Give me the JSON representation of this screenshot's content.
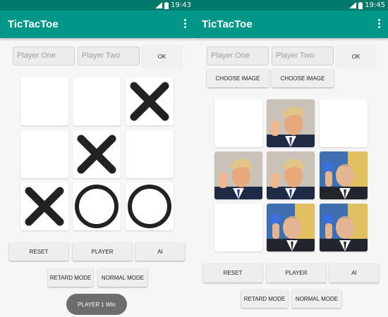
{
  "status_bar": {
    "left_time": "19:43",
    "right_time": "19:45"
  },
  "app": {
    "title": "TicTacToe"
  },
  "left": {
    "player_one_placeholder": "Player One",
    "player_two_placeholder": "Player Two",
    "ok_label": "OK",
    "board": [
      [
        "empty",
        "empty",
        "X"
      ],
      [
        "empty",
        "X",
        "empty"
      ],
      [
        "X",
        "O",
        "O"
      ]
    ],
    "reset_label": "RESET",
    "player_label": "PLAYER",
    "ai_label": "AI",
    "retard_mode_label": "RETARD MODE",
    "normal_mode_label": "NORMAL MODE",
    "toast_text": "PLAYER 1 Win"
  },
  "right": {
    "player_one_placeholder": "Player One",
    "player_two_placeholder": "Player Two",
    "ok_label": "OK",
    "choose_image_1": "CHOOSE IMAGE",
    "choose_image_2": "CHOOSE IMAGE",
    "board": [
      [
        "empty",
        "photo-a",
        "empty"
      ],
      [
        "photo-a",
        "photo-a",
        "photo-b"
      ],
      [
        "empty",
        "photo-b",
        "photo-b"
      ]
    ],
    "reset_label": "RESET",
    "player_label": "PLAYER",
    "ai_label": "AI",
    "retard_mode_label": "RETARD MODE",
    "normal_mode_label": "NORMAL MODE"
  },
  "colors": {
    "primary": "#009688",
    "primary_dark": "#00796b",
    "mark": "#222222",
    "toast": "#6d6d6d"
  },
  "icons": {
    "overflow": "overflow-menu-icon",
    "signal": "signal-icon",
    "battery": "battery-icon"
  }
}
